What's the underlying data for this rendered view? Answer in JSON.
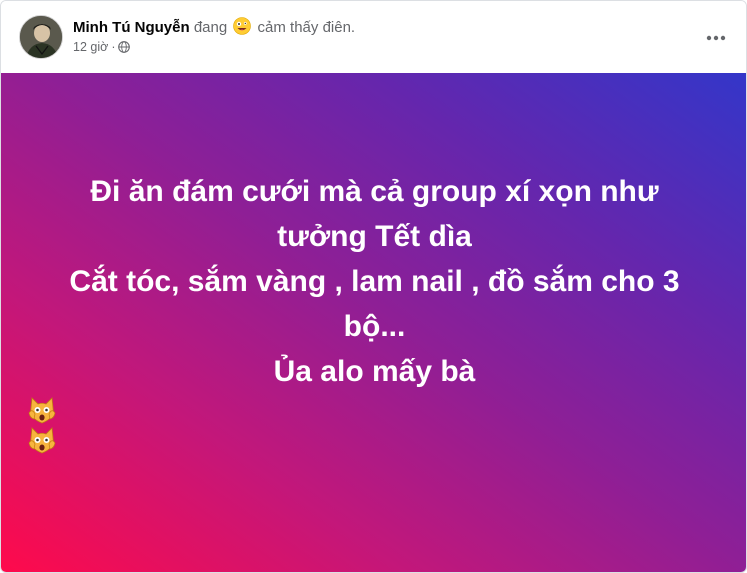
{
  "post": {
    "author_name": "Minh Tú Nguyễn",
    "feeling_prefix": "đang",
    "feeling_emoji": "crazy-face-emoji",
    "feeling_text": "cảm thấy điên.",
    "timestamp": "12 giờ",
    "separator": "·",
    "audience_icon": "globe-icon",
    "more_icon": "more-options-icon",
    "text_lines": [
      "Đi ăn đám cưới mà cả group xí xọn như",
      "tưởng Tết dìa",
      "Cắt tóc, sắm vàng , lam nail , đồ sắm cho 3",
      "bộ...",
      "Ủa alo mấy bà"
    ],
    "trailing_emojis": [
      "weary-cat-emoji",
      "weary-cat-emoji"
    ],
    "background_gradient": [
      "#ff0a4b",
      "#c3177a",
      "#8e1f96",
      "#6526ad",
      "#3336c9"
    ]
  }
}
